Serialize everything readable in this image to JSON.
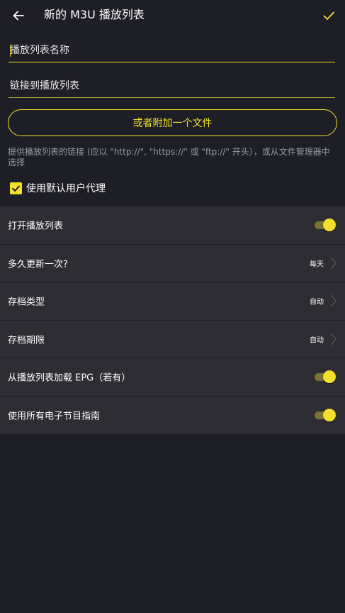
{
  "appbar": {
    "title": "新的 M3U 播放列表",
    "back_icon": "arrow-left-icon",
    "confirm_icon": "check-icon"
  },
  "form": {
    "name_placeholder": "播放列表名称",
    "name_value": "",
    "link_placeholder": "链接到播放列表",
    "link_value": "",
    "attach_label": "或者附加一个文件",
    "hint": "提供播放列表的链接 (应以 \"http://\", \"https://\" 或 \"ftp://\" 开头），或从文件管理器中选择",
    "default_user_agent_label": "使用默认用户代理",
    "default_user_agent_checked": true
  },
  "settings": {
    "open_playlist": {
      "label": "打开播放列表",
      "enabled": true
    },
    "update_frequency": {
      "label": "多久更新一次?",
      "value": "每天"
    },
    "archive_type": {
      "label": "存档类型",
      "value": "自动"
    },
    "archive_period": {
      "label": "存档期限",
      "value": "自动"
    },
    "load_epg": {
      "label": "从播放列表加载 EPG（若有）",
      "enabled": true
    },
    "use_all_epg": {
      "label": "使用所有电子节目指南",
      "enabled": true
    }
  },
  "colors": {
    "accent": "#f2e02c",
    "background": "#1e1e26",
    "row_background": "#2d2d33",
    "hint_text": "#9a9aa2"
  }
}
